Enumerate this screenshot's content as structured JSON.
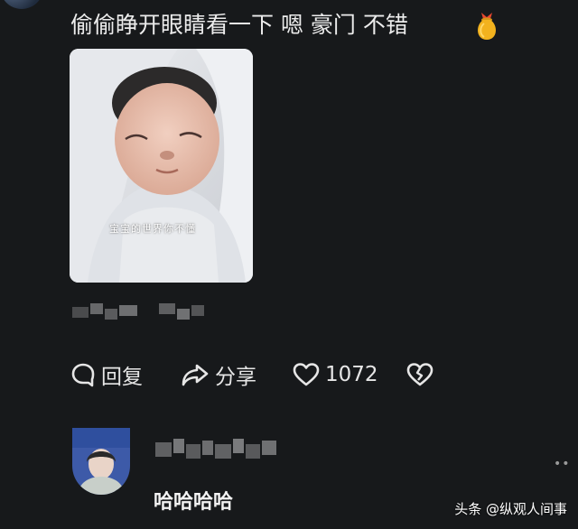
{
  "comment": {
    "text": "偷偷睁开眼睛看一下 嗯 豪门 不错",
    "emoji_icon": "money-bag-emoji",
    "photo_caption": "宝宝的世界你不懂"
  },
  "actions": {
    "reply_label": "回复",
    "share_label": "分享",
    "like_count": "1072"
  },
  "reply": {
    "text": "哈哈哈哈"
  },
  "watermark": {
    "text": "头条 @纵观人间事"
  },
  "colors": {
    "background": "#17191b",
    "text": "#e8e8e8",
    "bag_gold": "#f2b21e",
    "bag_ribbon": "#e8472f"
  }
}
